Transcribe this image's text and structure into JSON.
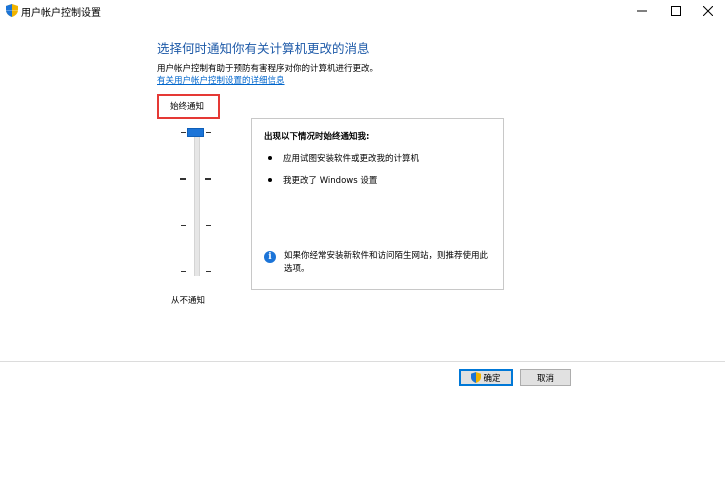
{
  "window": {
    "title": "用户帐户控制设置",
    "controls": [
      "minimize",
      "maximize",
      "close"
    ]
  },
  "main": {
    "heading": "选择何时通知你有关计算机更改的消息",
    "description": "用户帐户控制有助于预防有害程序对你的计算机进行更改。",
    "details_link": "有关用户帐户控制设置的详细信息"
  },
  "slider": {
    "current_level_label": "始终通知",
    "bottom_label": "从不通知",
    "levels": 4,
    "selected_level": 4
  },
  "panel": {
    "title": "出现以下情况时始终通知我:",
    "bullets": [
      "应用试图安装软件或更改我的计算机",
      "我更改了 Windows 设置"
    ],
    "info_text": "如果你经常安装新软件和访问陌生网站，则推荐使用此选项。"
  },
  "buttons": {
    "ok_label": "确定",
    "cancel_label": "取消"
  },
  "colors": {
    "heading": "#1e5aa8",
    "link": "#0066cc",
    "highlight_box": "#e53935",
    "slider_thumb": "#1b74d8",
    "info_icon": "#1b74d8"
  },
  "icons": {
    "app": "uac-shield-icon",
    "info": "info-icon",
    "ok_button": "uac-shield-icon"
  }
}
